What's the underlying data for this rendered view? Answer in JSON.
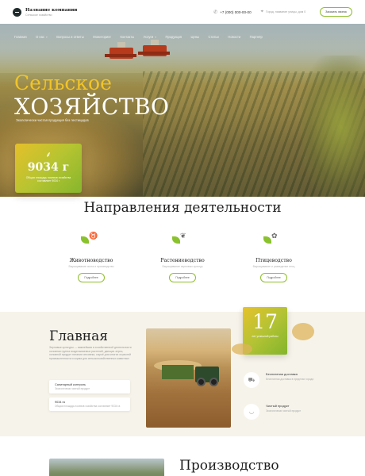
{
  "header": {
    "company_name": "Название компании",
    "company_tagline": "Сельское хозяйство",
    "phone": "+7 (000) 000-00-00",
    "address": "Город, название улицы, дом 0",
    "callback_label": "Заказать звонок"
  },
  "nav": {
    "items": [
      {
        "label": "Главная",
        "has_dropdown": false
      },
      {
        "label": "О нас",
        "has_dropdown": true
      },
      {
        "label": "Вопросы и ответы",
        "has_dropdown": false
      },
      {
        "label": "Мониторинг",
        "has_dropdown": false
      },
      {
        "label": "Контакты",
        "has_dropdown": false
      },
      {
        "label": "Услуги",
        "has_dropdown": true
      },
      {
        "label": "Продукция",
        "has_dropdown": false
      },
      {
        "label": "Цены",
        "has_dropdown": false
      },
      {
        "label": "Статьи",
        "has_dropdown": false
      },
      {
        "label": "Новости",
        "has_dropdown": false
      },
      {
        "label": "Партнёр",
        "has_dropdown": false
      }
    ]
  },
  "hero": {
    "title_line1": "Сельское",
    "title_line2": "ХОЗЯЙСТВО",
    "subtitle": "Экологически чистая продукция без пестицидов",
    "stat_value": "9034 г",
    "stat_caption": "Общая площадь посевов хозяйства составляет 9034 г"
  },
  "directions": {
    "title": "Направления деятельности",
    "more_label": "Подробнее",
    "items": [
      {
        "label": "Животноводство",
        "desc": "Выращивание скота и производство"
      },
      {
        "label": "Растениеводство",
        "desc": "Выращивание зерновых культур"
      },
      {
        "label": "Птицеводство",
        "desc": "Выращивание и разведение птиц"
      }
    ]
  },
  "about": {
    "title": "Главная",
    "text": "Зерновые культуры — важнейшая в хозяйственной деятельности основная группа возделываемых растений, дающих зерно, основной продукт питания человека, сырьё для многих отраслей промышленности и корма для сельскохозяйственных животных",
    "cards": [
      {
        "title": "Санитарный контроль",
        "desc": "Экологически чистый продукт"
      },
      {
        "title": "9034 га",
        "desc": "Общая площадь посевов хозяйства составляет 9034 га"
      }
    ],
    "years_value": "17",
    "years_caption": "лет успешной работы",
    "features": [
      {
        "title": "Бесплатная доставка",
        "desc": "Бесплатная доставка в пределах города"
      },
      {
        "title": "Чистый продукт",
        "desc": "Экологически чистый продукт"
      }
    ]
  },
  "production": {
    "title": "Производство"
  },
  "colors": {
    "accent_green": "#8ac22e",
    "accent_yellow": "#f1c429",
    "section_beige": "#f6f3ea"
  }
}
